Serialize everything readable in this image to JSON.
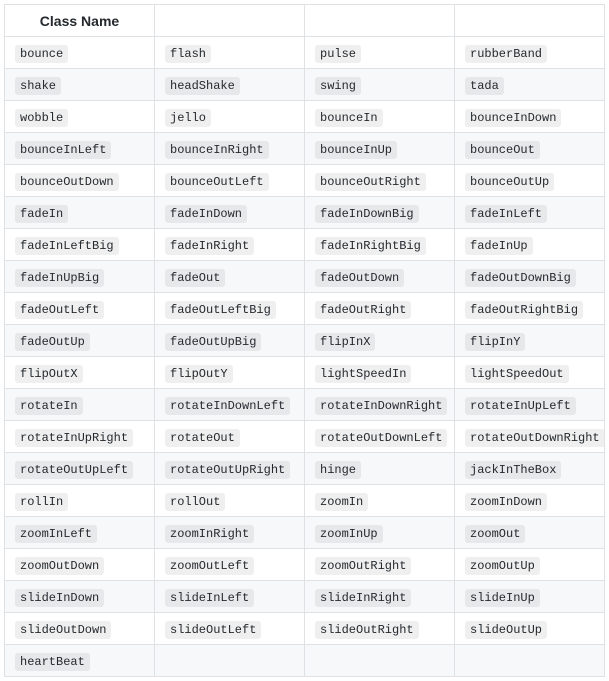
{
  "table": {
    "header": [
      "Class Name",
      "",
      "",
      ""
    ],
    "rows": [
      [
        "bounce",
        "flash",
        "pulse",
        "rubberBand"
      ],
      [
        "shake",
        "headShake",
        "swing",
        "tada"
      ],
      [
        "wobble",
        "jello",
        "bounceIn",
        "bounceInDown"
      ],
      [
        "bounceInLeft",
        "bounceInRight",
        "bounceInUp",
        "bounceOut"
      ],
      [
        "bounceOutDown",
        "bounceOutLeft",
        "bounceOutRight",
        "bounceOutUp"
      ],
      [
        "fadeIn",
        "fadeInDown",
        "fadeInDownBig",
        "fadeInLeft"
      ],
      [
        "fadeInLeftBig",
        "fadeInRight",
        "fadeInRightBig",
        "fadeInUp"
      ],
      [
        "fadeInUpBig",
        "fadeOut",
        "fadeOutDown",
        "fadeOutDownBig"
      ],
      [
        "fadeOutLeft",
        "fadeOutLeftBig",
        "fadeOutRight",
        "fadeOutRightBig"
      ],
      [
        "fadeOutUp",
        "fadeOutUpBig",
        "flipInX",
        "flipInY"
      ],
      [
        "flipOutX",
        "flipOutY",
        "lightSpeedIn",
        "lightSpeedOut"
      ],
      [
        "rotateIn",
        "rotateInDownLeft",
        "rotateInDownRight",
        "rotateInUpLeft"
      ],
      [
        "rotateInUpRight",
        "rotateOut",
        "rotateOutDownLeft",
        "rotateOutDownRight"
      ],
      [
        "rotateOutUpLeft",
        "rotateOutUpRight",
        "hinge",
        "jackInTheBox"
      ],
      [
        "rollIn",
        "rollOut",
        "zoomIn",
        "zoomInDown"
      ],
      [
        "zoomInLeft",
        "zoomInRight",
        "zoomInUp",
        "zoomOut"
      ],
      [
        "zoomOutDown",
        "zoomOutLeft",
        "zoomOutRight",
        "zoomOutUp"
      ],
      [
        "slideInDown",
        "slideInLeft",
        "slideInRight",
        "slideInUp"
      ],
      [
        "slideOutDown",
        "slideOutLeft",
        "slideOutRight",
        "slideOutUp"
      ],
      [
        "heartBeat",
        "",
        "",
        ""
      ]
    ]
  }
}
